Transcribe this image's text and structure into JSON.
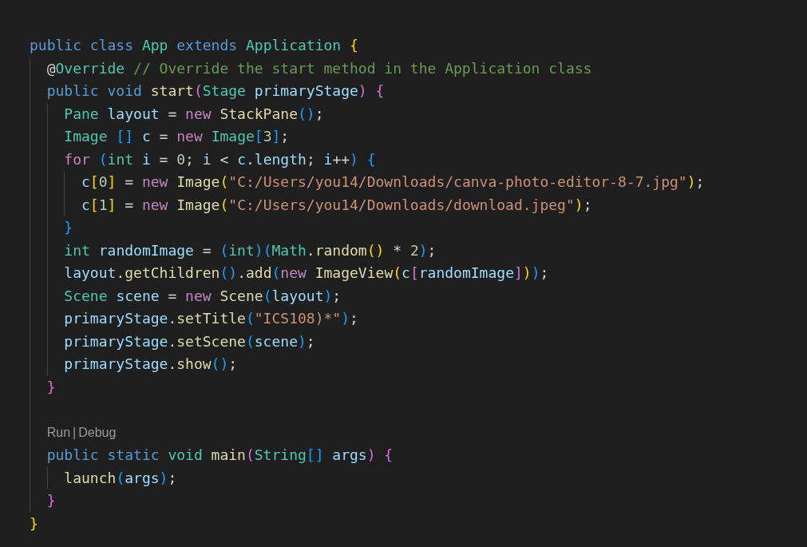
{
  "editor": {
    "lines": [
      {
        "kind": "code",
        "tokens": [
          {
            "text": "public ",
            "kind": "kw"
          },
          {
            "text": "class ",
            "kind": "kw"
          },
          {
            "text": "App ",
            "kind": "type"
          },
          {
            "text": "extends ",
            "kind": "kw"
          },
          {
            "text": "Application ",
            "kind": "type"
          },
          {
            "text": "{",
            "kind": "b1"
          }
        ],
        "children": [
          {
            "kind": "code",
            "tokens": [
              {
                "text": "@",
                "kind": "p"
              },
              {
                "text": "Override ",
                "kind": "type"
              },
              {
                "text": "// Override the start method in the Application class",
                "kind": "comment"
              }
            ]
          },
          {
            "kind": "code",
            "tokens": [
              {
                "text": "public ",
                "kind": "kw"
              },
              {
                "text": "void ",
                "kind": "kw"
              },
              {
                "text": "start",
                "kind": "fn"
              },
              {
                "text": "(",
                "kind": "b2"
              },
              {
                "text": "Stage ",
                "kind": "type"
              },
              {
                "text": "primaryStage",
                "kind": "var"
              },
              {
                "text": ")",
                "kind": "b2"
              },
              {
                "text": " {",
                "kind": "b2"
              }
            ],
            "children": [
              {
                "kind": "code",
                "tokens": [
                  {
                    "text": "Pane ",
                    "kind": "type"
                  },
                  {
                    "text": "layout",
                    "kind": "var"
                  },
                  {
                    "text": " = ",
                    "kind": "p"
                  },
                  {
                    "text": "new ",
                    "kind": "ctrl"
                  },
                  {
                    "text": "StackPane",
                    "kind": "fn"
                  },
                  {
                    "text": "()",
                    "kind": "b3"
                  },
                  {
                    "text": ";",
                    "kind": "p"
                  }
                ]
              },
              {
                "kind": "code",
                "tokens": [
                  {
                    "text": "Image ",
                    "kind": "type"
                  },
                  {
                    "text": "[]",
                    "kind": "b3"
                  },
                  {
                    "text": " c",
                    "kind": "var"
                  },
                  {
                    "text": " = ",
                    "kind": "p"
                  },
                  {
                    "text": "new ",
                    "kind": "ctrl"
                  },
                  {
                    "text": "Image",
                    "kind": "type"
                  },
                  {
                    "text": "[",
                    "kind": "b3"
                  },
                  {
                    "text": "3",
                    "kind": "num"
                  },
                  {
                    "text": "]",
                    "kind": "b3"
                  },
                  {
                    "text": ";",
                    "kind": "p"
                  }
                ]
              },
              {
                "kind": "code",
                "tokens": [
                  {
                    "text": "for ",
                    "kind": "ctrl"
                  },
                  {
                    "text": "(",
                    "kind": "b3"
                  },
                  {
                    "text": "int ",
                    "kind": "type"
                  },
                  {
                    "text": "i",
                    "kind": "var"
                  },
                  {
                    "text": " = ",
                    "kind": "p"
                  },
                  {
                    "text": "0",
                    "kind": "num"
                  },
                  {
                    "text": "; ",
                    "kind": "p"
                  },
                  {
                    "text": "i",
                    "kind": "var"
                  },
                  {
                    "text": " < ",
                    "kind": "p"
                  },
                  {
                    "text": "c",
                    "kind": "var"
                  },
                  {
                    "text": ".",
                    "kind": "p"
                  },
                  {
                    "text": "length",
                    "kind": "var"
                  },
                  {
                    "text": "; ",
                    "kind": "p"
                  },
                  {
                    "text": "i",
                    "kind": "var"
                  },
                  {
                    "text": "++",
                    "kind": "p"
                  },
                  {
                    "text": ")",
                    "kind": "b3"
                  },
                  {
                    "text": " {",
                    "kind": "b3"
                  }
                ],
                "children": [
                  {
                    "kind": "code",
                    "tokens": [
                      {
                        "text": "c",
                        "kind": "var"
                      },
                      {
                        "text": "[",
                        "kind": "b1"
                      },
                      {
                        "text": "0",
                        "kind": "num"
                      },
                      {
                        "text": "]",
                        "kind": "b1"
                      },
                      {
                        "text": " = ",
                        "kind": "p"
                      },
                      {
                        "text": "new ",
                        "kind": "ctrl"
                      },
                      {
                        "text": "Image",
                        "kind": "fn"
                      },
                      {
                        "text": "(",
                        "kind": "b1"
                      },
                      {
                        "text": "\"C:/Users/you14/Downloads/canva-photo-editor-8-7.jpg\"",
                        "kind": "str"
                      },
                      {
                        "text": ")",
                        "kind": "b1"
                      },
                      {
                        "text": ";",
                        "kind": "p"
                      }
                    ]
                  },
                  {
                    "kind": "code",
                    "tokens": [
                      {
                        "text": "c",
                        "kind": "var"
                      },
                      {
                        "text": "[",
                        "kind": "b1"
                      },
                      {
                        "text": "1",
                        "kind": "num"
                      },
                      {
                        "text": "]",
                        "kind": "b1"
                      },
                      {
                        "text": " = ",
                        "kind": "p"
                      },
                      {
                        "text": "new ",
                        "kind": "ctrl"
                      },
                      {
                        "text": "Image",
                        "kind": "fn"
                      },
                      {
                        "text": "(",
                        "kind": "b1"
                      },
                      {
                        "text": "\"C:/Users/you14/Downloads/download.jpeg\"",
                        "kind": "str"
                      },
                      {
                        "text": ")",
                        "kind": "b1"
                      },
                      {
                        "text": ";",
                        "kind": "p"
                      }
                    ]
                  }
                ]
              },
              {
                "kind": "code",
                "tokens": [
                  {
                    "text": "}",
                    "kind": "b3"
                  }
                ]
              },
              {
                "kind": "code",
                "tokens": [
                  {
                    "text": "int ",
                    "kind": "type"
                  },
                  {
                    "text": "randomImage",
                    "kind": "var"
                  },
                  {
                    "text": " = ",
                    "kind": "p"
                  },
                  {
                    "text": "(",
                    "kind": "b3"
                  },
                  {
                    "text": "int",
                    "kind": "type"
                  },
                  {
                    "text": ")",
                    "kind": "b3"
                  },
                  {
                    "text": "(",
                    "kind": "b3"
                  },
                  {
                    "text": "Math",
                    "kind": "type"
                  },
                  {
                    "text": ".",
                    "kind": "p"
                  },
                  {
                    "text": "random",
                    "kind": "fn"
                  },
                  {
                    "text": "()",
                    "kind": "b1"
                  },
                  {
                    "text": " * ",
                    "kind": "p"
                  },
                  {
                    "text": "2",
                    "kind": "num"
                  },
                  {
                    "text": ")",
                    "kind": "b3"
                  },
                  {
                    "text": ";",
                    "kind": "p"
                  }
                ]
              },
              {
                "kind": "code",
                "tokens": [
                  {
                    "text": "layout",
                    "kind": "var"
                  },
                  {
                    "text": ".",
                    "kind": "p"
                  },
                  {
                    "text": "getChildren",
                    "kind": "fn"
                  },
                  {
                    "text": "()",
                    "kind": "b3"
                  },
                  {
                    "text": ".",
                    "kind": "p"
                  },
                  {
                    "text": "add",
                    "kind": "fn"
                  },
                  {
                    "text": "(",
                    "kind": "b3"
                  },
                  {
                    "text": "new ",
                    "kind": "ctrl"
                  },
                  {
                    "text": "ImageView",
                    "kind": "fn"
                  },
                  {
                    "text": "(",
                    "kind": "b1"
                  },
                  {
                    "text": "c",
                    "kind": "var"
                  },
                  {
                    "text": "[",
                    "kind": "b2"
                  },
                  {
                    "text": "randomImage",
                    "kind": "var"
                  },
                  {
                    "text": "]",
                    "kind": "b2"
                  },
                  {
                    "text": ")",
                    "kind": "b1"
                  },
                  {
                    "text": ")",
                    "kind": "b3"
                  },
                  {
                    "text": ";",
                    "kind": "p"
                  }
                ]
              },
              {
                "kind": "code",
                "tokens": [
                  {
                    "text": "Scene ",
                    "kind": "type"
                  },
                  {
                    "text": "scene",
                    "kind": "var"
                  },
                  {
                    "text": " = ",
                    "kind": "p"
                  },
                  {
                    "text": "new ",
                    "kind": "ctrl"
                  },
                  {
                    "text": "Scene",
                    "kind": "fn"
                  },
                  {
                    "text": "(",
                    "kind": "b3"
                  },
                  {
                    "text": "layout",
                    "kind": "var"
                  },
                  {
                    "text": ")",
                    "kind": "b3"
                  },
                  {
                    "text": ";",
                    "kind": "p"
                  }
                ]
              },
              {
                "kind": "code",
                "tokens": [
                  {
                    "text": "primaryStage",
                    "kind": "var"
                  },
                  {
                    "text": ".",
                    "kind": "p"
                  },
                  {
                    "text": "setTitle",
                    "kind": "fn"
                  },
                  {
                    "text": "(",
                    "kind": "b3"
                  },
                  {
                    "text": "\"ICS108)*\"",
                    "kind": "str"
                  },
                  {
                    "text": ")",
                    "kind": "b3"
                  },
                  {
                    "text": ";",
                    "kind": "p"
                  }
                ]
              },
              {
                "kind": "code",
                "tokens": [
                  {
                    "text": "primaryStage",
                    "kind": "var"
                  },
                  {
                    "text": ".",
                    "kind": "p"
                  },
                  {
                    "text": "setScene",
                    "kind": "fn"
                  },
                  {
                    "text": "(",
                    "kind": "b3"
                  },
                  {
                    "text": "scene",
                    "kind": "var"
                  },
                  {
                    "text": ")",
                    "kind": "b3"
                  },
                  {
                    "text": ";",
                    "kind": "p"
                  }
                ]
              },
              {
                "kind": "code",
                "tokens": [
                  {
                    "text": "primaryStage",
                    "kind": "var"
                  },
                  {
                    "text": ".",
                    "kind": "p"
                  },
                  {
                    "text": "show",
                    "kind": "fn"
                  },
                  {
                    "text": "()",
                    "kind": "b3"
                  },
                  {
                    "text": ";",
                    "kind": "p"
                  }
                ]
              }
            ]
          },
          {
            "kind": "code",
            "tokens": [
              {
                "text": "}",
                "kind": "b2"
              }
            ]
          },
          {
            "kind": "codelens",
            "items": [
              "Run",
              "|",
              "Debug"
            ]
          },
          {
            "kind": "code",
            "tokens": [
              {
                "text": "public ",
                "kind": "kw"
              },
              {
                "text": "static ",
                "kind": "kw"
              },
              {
                "text": "void ",
                "kind": "type"
              },
              {
                "text": "main",
                "kind": "fn"
              },
              {
                "text": "(",
                "kind": "b2"
              },
              {
                "text": "String",
                "kind": "type"
              },
              {
                "text": "[]",
                "kind": "b3"
              },
              {
                "text": " args",
                "kind": "var"
              },
              {
                "text": ")",
                "kind": "b2"
              },
              {
                "text": " {",
                "kind": "b2"
              }
            ],
            "children": [
              {
                "kind": "code",
                "tokens": [
                  {
                    "text": "launch",
                    "kind": "fn"
                  },
                  {
                    "text": "(",
                    "kind": "b3"
                  },
                  {
                    "text": "args",
                    "kind": "var"
                  },
                  {
                    "text": ")",
                    "kind": "b3"
                  },
                  {
                    "text": ";",
                    "kind": "p"
                  }
                ]
              }
            ]
          },
          {
            "kind": "code",
            "tokens": [
              {
                "text": "}",
                "kind": "b2"
              }
            ]
          }
        ]
      },
      {
        "kind": "code",
        "tokens": [
          {
            "text": "}",
            "kind": "b1"
          }
        ]
      }
    ]
  }
}
